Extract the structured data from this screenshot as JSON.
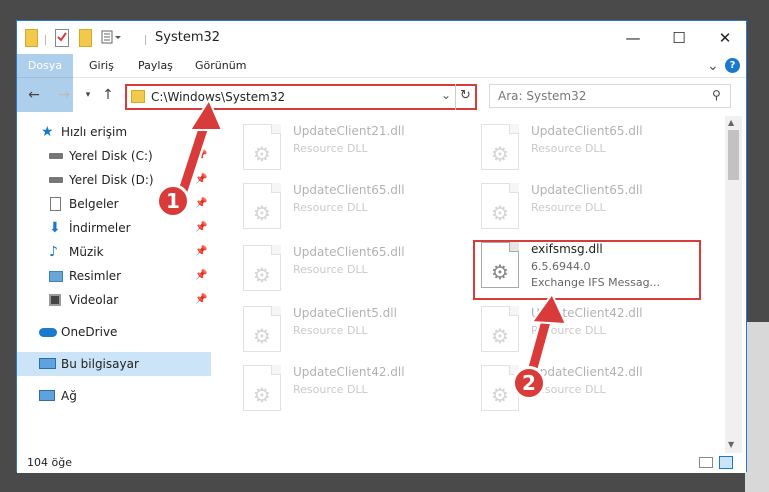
{
  "window": {
    "title": "System32",
    "accent_color": "#1979ca",
    "highlight_color": "#d93a3a",
    "controls": {
      "minimize": "—",
      "maximize": "☐",
      "close": "✕"
    }
  },
  "ribbon": {
    "tabs": [
      "Dosya",
      "Giriş",
      "Paylaş",
      "Görünüm"
    ],
    "help_icon": "?",
    "expand_icon": "⌄"
  },
  "address": {
    "path": "C:\\Windows\\System32",
    "search_placeholder": "Ara: System32"
  },
  "sidebar": {
    "items": [
      {
        "label": "Hızlı erişim",
        "icon": "star-icon"
      },
      {
        "label": "Yerel Disk (C:)",
        "icon": "drive-icon",
        "pinned": true
      },
      {
        "label": "Yerel Disk (D:)",
        "icon": "drive-icon",
        "pinned": true
      },
      {
        "label": "Belgeler",
        "icon": "documents-icon",
        "pinned": true
      },
      {
        "label": "İndirmeler",
        "icon": "download-icon",
        "pinned": true
      },
      {
        "label": "Müzik",
        "icon": "music-icon",
        "pinned": true
      },
      {
        "label": "Resimler",
        "icon": "pictures-icon",
        "pinned": true
      },
      {
        "label": "Videolar",
        "icon": "videos-icon",
        "pinned": true
      },
      {
        "label": "OneDrive",
        "icon": "cloud-icon"
      },
      {
        "label": "Bu bilgisayar",
        "icon": "computer-icon",
        "selected": true
      },
      {
        "label": "Ağ",
        "icon": "network-icon"
      }
    ]
  },
  "files": [
    {
      "name": "UpdateClient21.dll",
      "type": "Resource DLL"
    },
    {
      "name": "UpdateClient65.dll",
      "type": "Resource DLL"
    },
    {
      "name": "UpdateClient65.dll",
      "type": "Resource DLL"
    },
    {
      "name": "UpdateClient65.dll",
      "type": "Resource DLL"
    },
    {
      "name": "UpdateClient65.dll",
      "type": "Resource DLL"
    },
    {
      "name": "exifsmsg.dll",
      "version": "6.5.6944.0",
      "type": "Exchange IFS Messag...",
      "highlighted": true
    },
    {
      "name": "UpdateClient5.dll",
      "type": "Resource DLL"
    },
    {
      "name": "UpdateClient42.dll",
      "type": "Resource DLL"
    },
    {
      "name": "UpdateClient42.dll",
      "type": "Resource DLL"
    },
    {
      "name": "UpdateClient42.dll",
      "type": "Resource DLL"
    }
  ],
  "status": {
    "item_count": "104 öğe"
  },
  "annotations": {
    "step1": "1",
    "step2": "2"
  }
}
